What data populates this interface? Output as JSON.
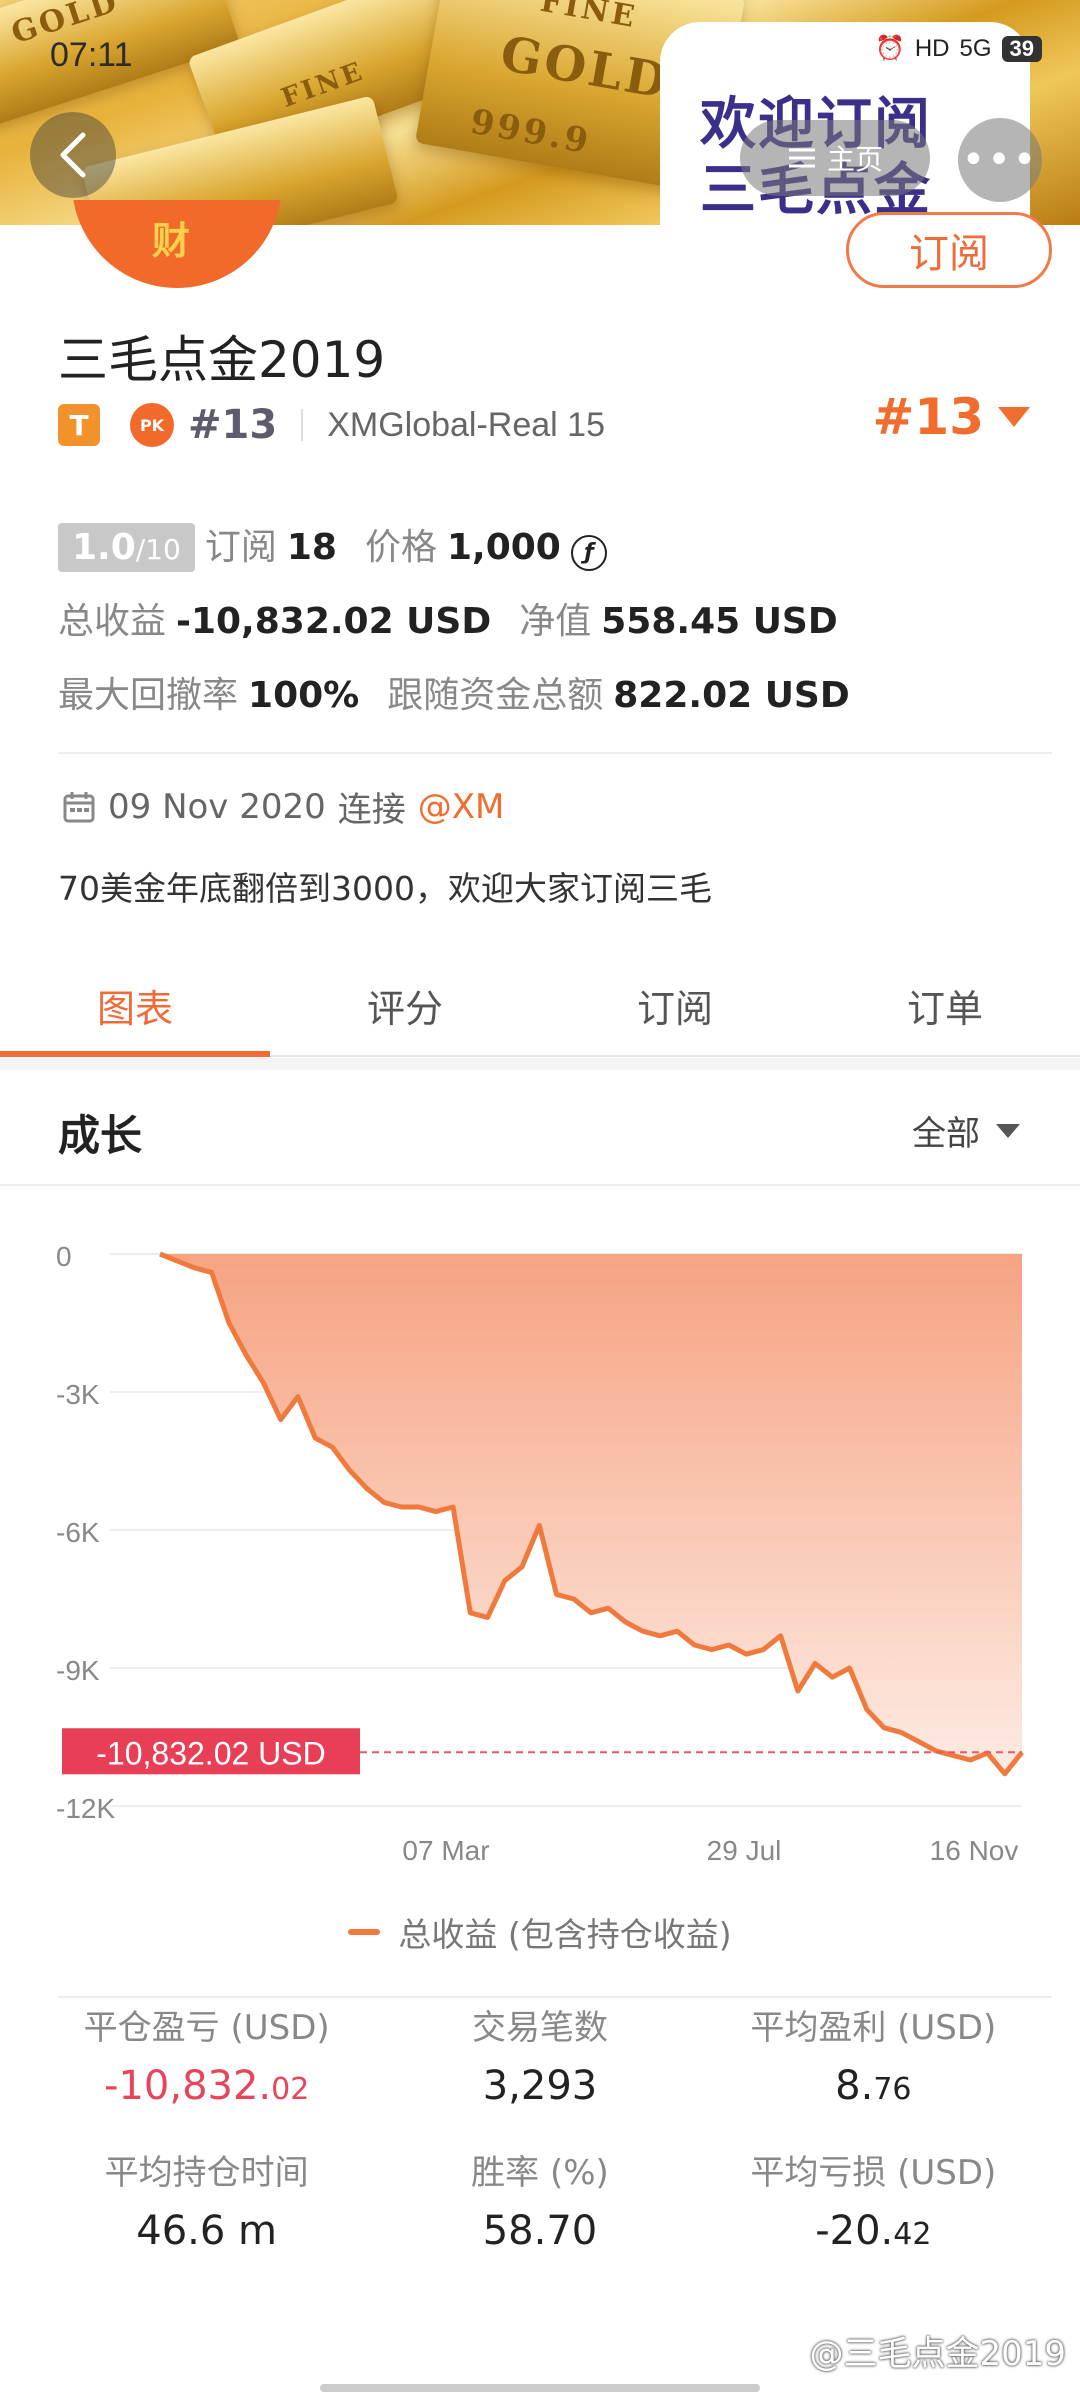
{
  "status_bar": {
    "time": "07:11",
    "network": "5G",
    "hd": "HD",
    "battery": "39"
  },
  "banner": {
    "bar_texts": [
      "GOLD",
      "FINE",
      "GOLD",
      "999.9",
      "FINE"
    ],
    "promo_line1": "欢迎订阅",
    "promo_line2": "三毛点金",
    "home_label": "主页",
    "more_label": "•••"
  },
  "avatar": {
    "char": "财"
  },
  "subscribe_button": "订阅",
  "profile": {
    "name": "三毛点金2019",
    "t_badge": "T",
    "pk_badge": "PK",
    "rank_small": "#13",
    "account": "XMGlobal-Real 15",
    "rank_big": "#13"
  },
  "stats": {
    "score": "1.0",
    "score_max": "/10",
    "subscribe_label": "订阅",
    "subscribe_count": "18",
    "price_label": "价格",
    "price_value": "1,000",
    "coin_symbol": "ƒ",
    "total_profit_label": "总收益",
    "total_profit_value": "-10,832.02 USD",
    "net_label": "净值",
    "net_value": "558.45 USD",
    "drawdown_label": "最大回撤率",
    "drawdown_value": "100%",
    "follow_label": "跟随资金总额",
    "follow_value": "822.02 USD"
  },
  "connection": {
    "date": "09 Nov 2020",
    "connect_label": "连接",
    "broker": "@XM"
  },
  "description": "70美金年底翻倍到3000，欢迎大家订阅三毛",
  "tabs": [
    {
      "label": "图表",
      "active": true
    },
    {
      "label": "评分",
      "active": false
    },
    {
      "label": "订阅",
      "active": false
    },
    {
      "label": "订单",
      "active": false
    }
  ],
  "growth": {
    "title": "成长",
    "filter": "全部"
  },
  "chart_data": {
    "type": "area",
    "series_name": "总收益 (包含持仓收益)",
    "y_ticks": [
      "0",
      "-3K",
      "-6K",
      "-9K",
      "-12K"
    ],
    "x_ticks": [
      "07 Mar",
      "29 Jul",
      "16 Nov"
    ],
    "ylim": [
      -12000,
      0
    ],
    "current_label": "-10,832.02 USD",
    "current_value": -10832.02,
    "values": [
      0,
      -150,
      -300,
      -400,
      -1500,
      -2200,
      -2800,
      -3600,
      -3100,
      -4000,
      -4200,
      -4700,
      -5100,
      -5400,
      -5500,
      -5500,
      -5600,
      -5500,
      -7800,
      -7900,
      -7100,
      -6800,
      -5900,
      -7400,
      -7500,
      -7800,
      -7700,
      -8000,
      -8200,
      -8300,
      -8200,
      -8500,
      -8600,
      -8500,
      -8700,
      -8600,
      -8300,
      -9500,
      -8900,
      -9200,
      -9000,
      -9900,
      -10300,
      -10400,
      -10600,
      -10800,
      -10900,
      -11000,
      -10850,
      -11300,
      -10832
    ],
    "fill_top": "#f6a382",
    "line_color": "#f07a3e"
  },
  "summary": [
    {
      "label": "平仓盈亏 (USD)",
      "main": "-10,832.",
      "small": "02",
      "negative": true
    },
    {
      "label": "交易笔数",
      "main": "3,293",
      "small": "",
      "negative": false
    },
    {
      "label": "平均盈利 (USD)",
      "main": "8.",
      "small": "76",
      "negative": false
    },
    {
      "label": "平均持仓时间",
      "main": "46.6 m",
      "small": "",
      "negative": false
    },
    {
      "label": "胜率 (%)",
      "main": "58.70",
      "small": "",
      "negative": false
    },
    {
      "label": "平均亏损 (USD)",
      "main": "-20.",
      "small": "42",
      "negative": false
    }
  ],
  "watermark": "@三毛点金2019"
}
